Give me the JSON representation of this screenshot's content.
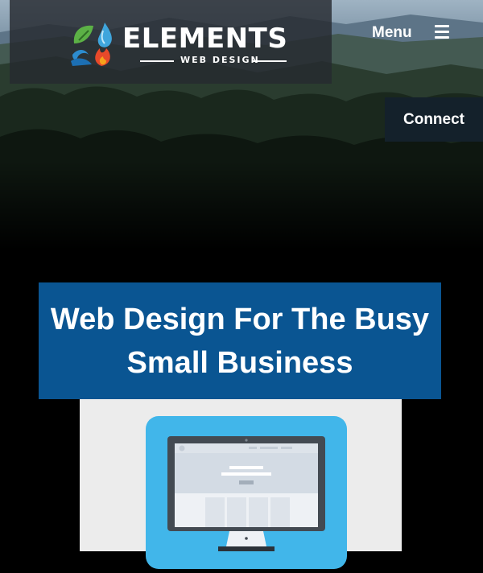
{
  "header": {
    "brand_name": "ELEMENTS",
    "brand_tagline": "WEB DESIGN",
    "menu_label": "Menu",
    "connect_label": "Connect"
  },
  "hero": {
    "headline_line1": "Web Design For The Busy",
    "headline_line2": "Small Business"
  },
  "icons": {
    "logo": "elements-logo-icon",
    "menu": "hamburger-menu-icon",
    "monitor": "monitor-illustration"
  },
  "colors": {
    "headline_bg": "#0a5592",
    "connect_bg": "#14212b",
    "monitor_tile": "#41b6ea",
    "page_bg": "#000000"
  }
}
